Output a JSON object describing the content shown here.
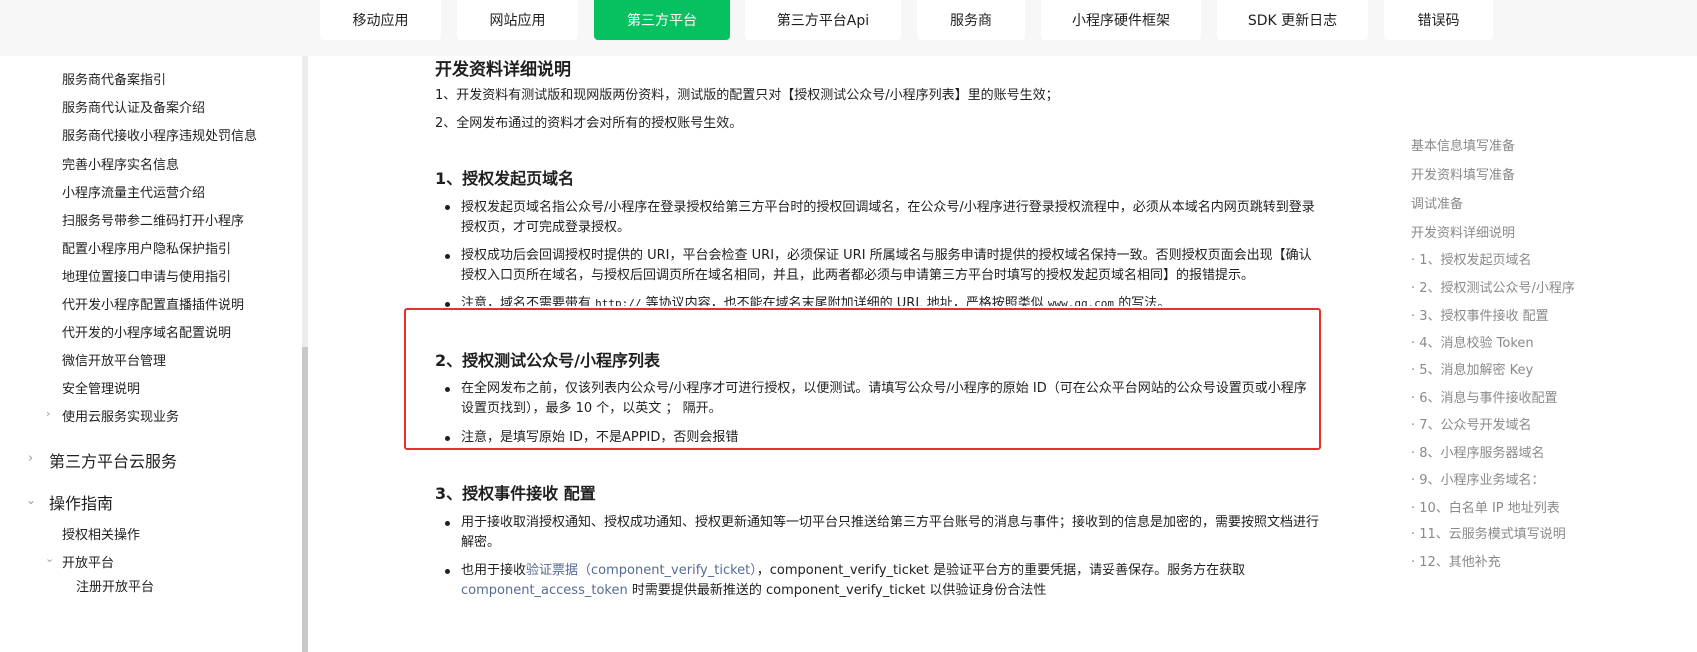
{
  "topnav": {
    "tabs": [
      {
        "label": "移动应用",
        "active": false
      },
      {
        "label": "网站应用",
        "active": false
      },
      {
        "label": "第三方平台",
        "active": true
      },
      {
        "label": "第三方平台Api",
        "active": false
      },
      {
        "label": "服务商",
        "active": false
      },
      {
        "label": "小程序硬件框架",
        "active": false
      },
      {
        "label": "SDK 更新日志",
        "active": false
      },
      {
        "label": "错误码",
        "active": false
      }
    ],
    "accent_color": "#07c160"
  },
  "sidebar": {
    "items": [
      "服务商代备案指引",
      "服务商代认证及备案介绍",
      "服务商代接收小程序违规处罚信息",
      "完善小程序实名信息",
      "小程序流量主代运营介绍",
      "扫服务号带参二维码打开小程序",
      "配置小程序用户隐私保护指引",
      "地理位置接口申请与使用指引",
      "代开发小程序配置直播插件说明",
      "代开发的小程序域名配置说明",
      "微信开放平台管理",
      "安全管理说明",
      "使用云服务实现业务"
    ],
    "group_cloud": "第三方平台云服务",
    "group_guide": "操作指南",
    "guide_items": [
      "授权相关操作",
      "开放平台",
      "注册开放平台"
    ]
  },
  "content": {
    "title": "开发资料详细说明",
    "intro": [
      "1、开发资料有测试版和现网版两份资料，测试版的配置只对【授权测试公众号/小程序列表】里的账号生效；",
      "2、全网发布通过的资料才会对所有的授权账号生效。"
    ],
    "section1": {
      "title": "1、授权发起页域名",
      "b1": "授权发起页域名指公众号/小程序在登录授权给第三方平台时的授权回调域名，在公众号/小程序进行登录授权流程中，必须从本域名内网页跳转到登录授权页，才可完成登录授权。",
      "b2": "授权成功后会回调授权时提供的 URI，平台会检查 URI，必须保证 URI 所属域名与服务申请时提供的授权域名保持一致。否则授权页面会出现【确认授权入口页所在域名，与授权后回调页所在域名相同，并且，此两者都必须与申请第三方平台时填写的授权发起页域名相同】的报错提示。",
      "b3_a": "注意，域名不需要带有 ",
      "b3_code1": "http://",
      "b3_b": " 等协议内容，也不能在域名末尾附加详细的 URL 地址，严格按照类似 ",
      "b3_code2": "www.qq.com",
      "b3_c": " 的写法。"
    },
    "section2": {
      "title": "2、授权测试公众号/小程序列表",
      "b1": "在全网发布之前，仅该列表内公众号/小程序才可进行授权，以便测试。请填写公众号/小程序的原始 ID（可在公众平台网站的公众号设置页或小程序设置页找到），最多 10 个，以英文 ； 隔开。",
      "b2": "注意，是填写原始 ID，不是APPID，否则会报错"
    },
    "section3": {
      "title": "3、授权事件接收 配置",
      "b1": "用于接收取消授权通知、授权成功通知、授权更新通知等一切平台只推送给第三方平台账号的消息与事件；接收到的信息是加密的，需要按照文档进行解密。",
      "b2_a": "也用于接收",
      "b2_link": "验证票据（component_verify_ticket）",
      "b2_b": "，component_verify_ticket 是验证平台方的重要凭据，请妥善保存。服务方在获取",
      "b2_link2": "component_access_token",
      "b2_c": " 时需要提供最新推送的 component_verify_ticket 以供验证身份合法性"
    },
    "highlight_color": "#e83030"
  },
  "toc": {
    "items": [
      "基本信息填写准备",
      "开发资料填写准备",
      "调试准备",
      "开发资料详细说明",
      "· 1、授权发起页域名",
      "· 2、授权测试公众号/小程序",
      "· 3、授权事件接收 配置",
      "· 4、消息校验 Token",
      "· 5、消息加解密 Key",
      "· 6、消息与事件接收配置",
      "· 7、公众号开发域名",
      "· 8、小程序服务器域名",
      "· 9、小程序业务域名：",
      "· 10、白名单 IP 地址列表",
      "· 11、云服务模式填写说明",
      "· 12、其他补充"
    ]
  }
}
